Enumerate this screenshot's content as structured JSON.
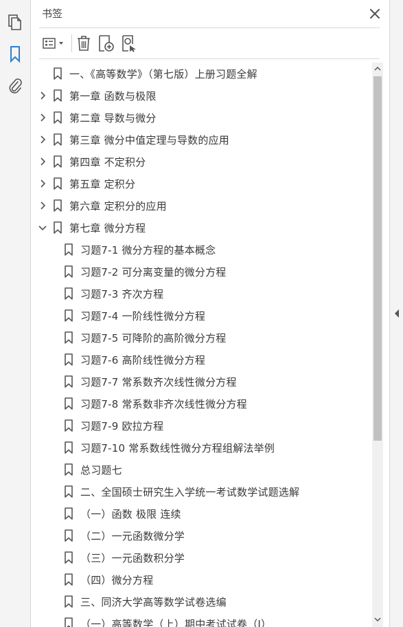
{
  "rail": {
    "items": [
      {
        "name": "pages-icon",
        "active": false
      },
      {
        "name": "bookmarks-icon",
        "active": true
      },
      {
        "name": "attachments-icon",
        "active": false
      }
    ]
  },
  "panel": {
    "title": "书签"
  },
  "toolbar": {
    "buttons": [
      "options-menu-button",
      "delete-bookmark-button",
      "new-bookmark-button",
      "find-current-bookmark-button"
    ]
  },
  "bookmarks": [
    {
      "label": "一、《高等数学》（第七版）上册习题全解",
      "level": 0,
      "expander": "none"
    },
    {
      "label": "第一章  函数与极限",
      "level": 0,
      "expander": "collapsed"
    },
    {
      "label": "第二章  导数与微分",
      "level": 0,
      "expander": "collapsed"
    },
    {
      "label": "第三章  微分中值定理与导数的应用",
      "level": 0,
      "expander": "collapsed"
    },
    {
      "label": "第四章  不定积分",
      "level": 0,
      "expander": "collapsed"
    },
    {
      "label": "第五章  定积分",
      "level": 0,
      "expander": "collapsed"
    },
    {
      "label": "第六章  定积分的应用",
      "level": 0,
      "expander": "collapsed"
    },
    {
      "label": "第七章  微分方程",
      "level": 0,
      "expander": "expanded"
    },
    {
      "label": "习题7-1  微分方程的基本概念",
      "level": 1,
      "expander": "none"
    },
    {
      "label": "习题7-2  可分离变量的微分方程",
      "level": 1,
      "expander": "none"
    },
    {
      "label": "习题7-3  齐次方程",
      "level": 1,
      "expander": "none"
    },
    {
      "label": "习题7-4  一阶线性微分方程",
      "level": 1,
      "expander": "none"
    },
    {
      "label": "习题7-5  可降阶的高阶微分方程",
      "level": 1,
      "expander": "none"
    },
    {
      "label": "习题7-6  高阶线性微分方程",
      "level": 1,
      "expander": "none"
    },
    {
      "label": "习题7-7  常系数齐次线性微分方程",
      "level": 1,
      "expander": "none"
    },
    {
      "label": "习题7-8  常系数非齐次线性微分方程",
      "level": 1,
      "expander": "none"
    },
    {
      "label": "习题7-9  欧拉方程",
      "level": 1,
      "expander": "none"
    },
    {
      "label": "习题7-10  常系数线性微分方程组解法举例",
      "level": 1,
      "expander": "none"
    },
    {
      "label": "总习题七",
      "level": 1,
      "expander": "none"
    },
    {
      "label": "二、全国硕士研究生入学统一考试数学试题选解",
      "level": 1,
      "expander": "none"
    },
    {
      "label": "（一）函数  极限  连续",
      "level": 1,
      "expander": "none"
    },
    {
      "label": "（二）一元函数微分学",
      "level": 1,
      "expander": "none"
    },
    {
      "label": "（三）一元函数积分学",
      "level": 1,
      "expander": "none"
    },
    {
      "label": "（四）微分方程",
      "level": 1,
      "expander": "none"
    },
    {
      "label": "三、同济大学高等数学试卷选编",
      "level": 1,
      "expander": "none"
    },
    {
      "label": "（一）高等数学（上）期中考试试卷（I）",
      "level": 1,
      "expander": "none"
    }
  ],
  "colors": {
    "accent": "#2d7fd2",
    "icon": "#555555",
    "text": "#3a3a3a"
  }
}
